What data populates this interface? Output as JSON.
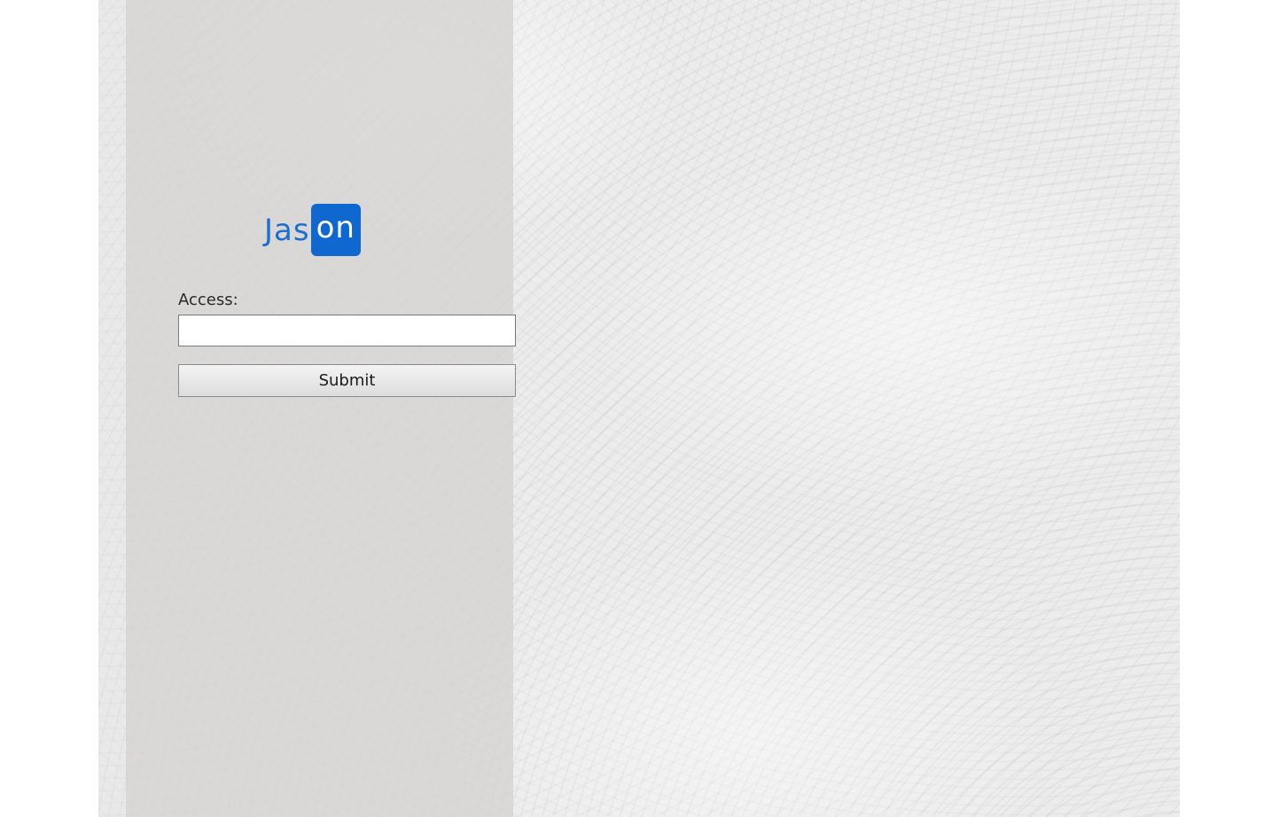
{
  "logo": {
    "text_plain": "Jas",
    "text_highlight": "on",
    "plain_color": "#1a6fd1",
    "highlight_bg": "#0f68cf",
    "highlight_color": "#ffffff"
  },
  "form": {
    "access_label": "Access:",
    "access_value": "",
    "access_placeholder": "",
    "submit_label": "Submit"
  },
  "colors": {
    "panel_overlay": "#d6d2d2",
    "background": "#ececec"
  }
}
